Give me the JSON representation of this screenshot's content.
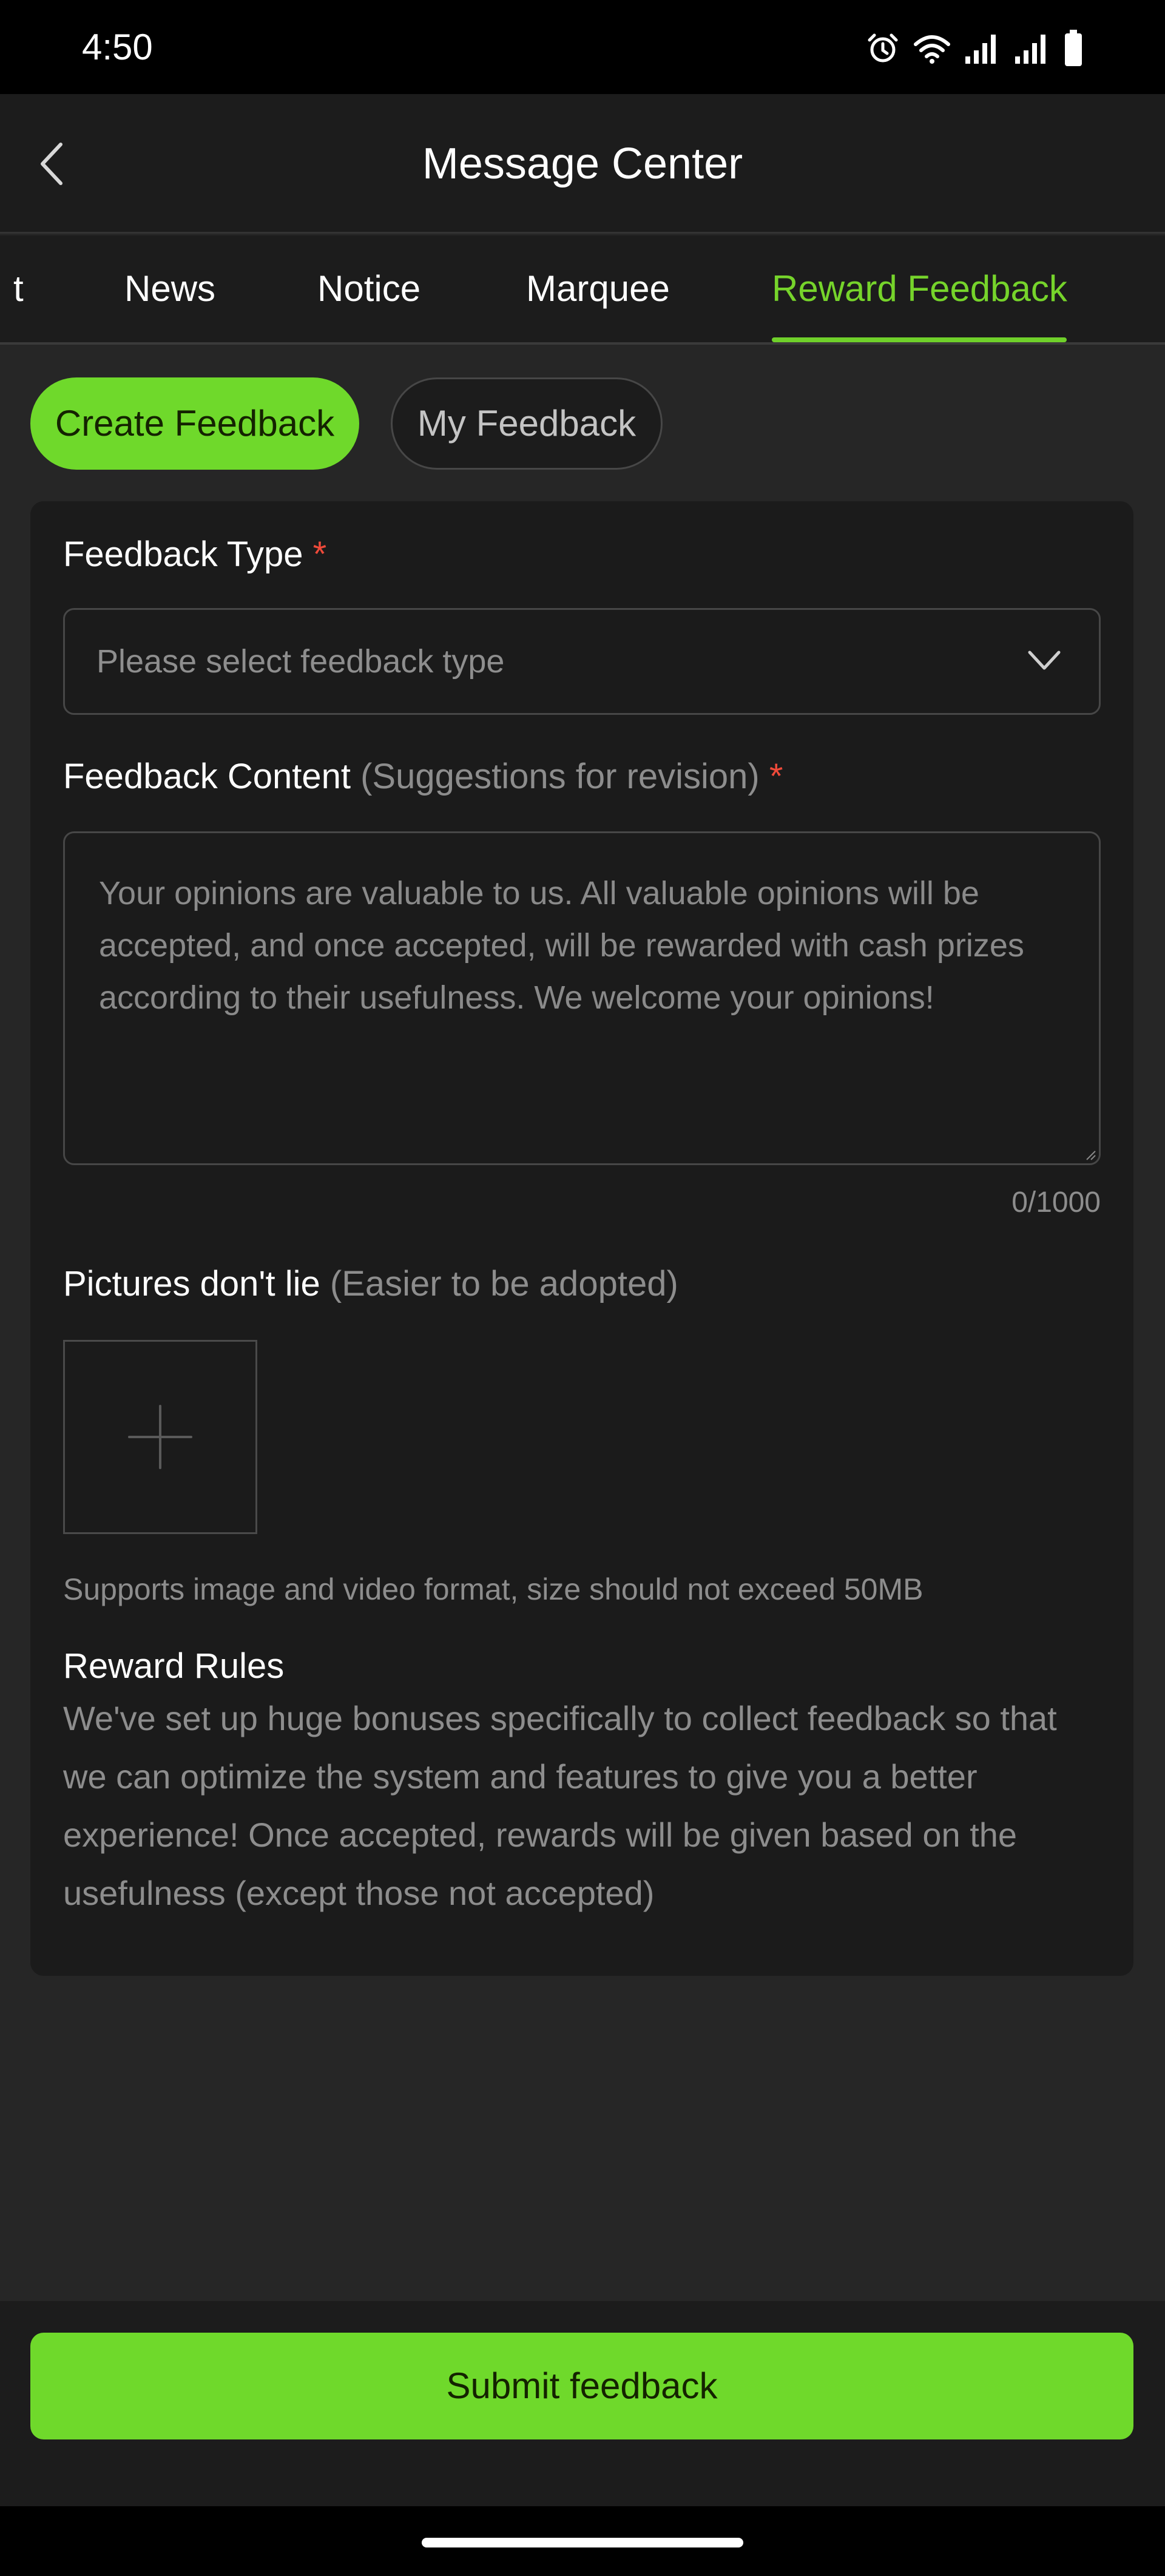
{
  "status_bar": {
    "time": "4:50",
    "icons": [
      "alarm-icon",
      "wifi-icon",
      "signal-icon",
      "signal-icon",
      "battery-icon"
    ]
  },
  "header": {
    "title": "Message Center",
    "back_icon": "chevron-left-icon"
  },
  "tabs": [
    {
      "label": "t",
      "active": false
    },
    {
      "label": "News",
      "active": false
    },
    {
      "label": "Notice",
      "active": false
    },
    {
      "label": "Marquee",
      "active": false
    },
    {
      "label": "Reward Feedback",
      "active": true
    }
  ],
  "sub_tabs": {
    "create": "Create Feedback",
    "mine": "My Feedback"
  },
  "form": {
    "type_label": "Feedback Type",
    "required_mark": "*",
    "type_placeholder": "Please select feedback type",
    "content_label": "Feedback Content",
    "content_hint": "(Suggestions for revision)",
    "content_placeholder": "Your opinions are valuable to us. All valuable opinions will be accepted, and once accepted, will be rewarded with cash prizes according to their usefulness. We welcome your opinions!",
    "char_count": "0/1000",
    "pictures_label": "Pictures don't lie",
    "pictures_hint": "(Easier to be adopted)",
    "upload_hint": "Supports image and video format, size should not exceed 50MB",
    "rules_title": "Reward Rules",
    "rules_body": "We've set up huge bonuses specifically to collect feedback so that we can optimize the system and features to give you a better experience! Once accepted, rewards will be given based on the usefulness (except those not accepted)"
  },
  "footer": {
    "submit_label": "Submit feedback"
  },
  "colors": {
    "accent": "#6fd92b",
    "background": "#262626",
    "card": "#1b1b1b",
    "required": "#ef4a3a"
  }
}
